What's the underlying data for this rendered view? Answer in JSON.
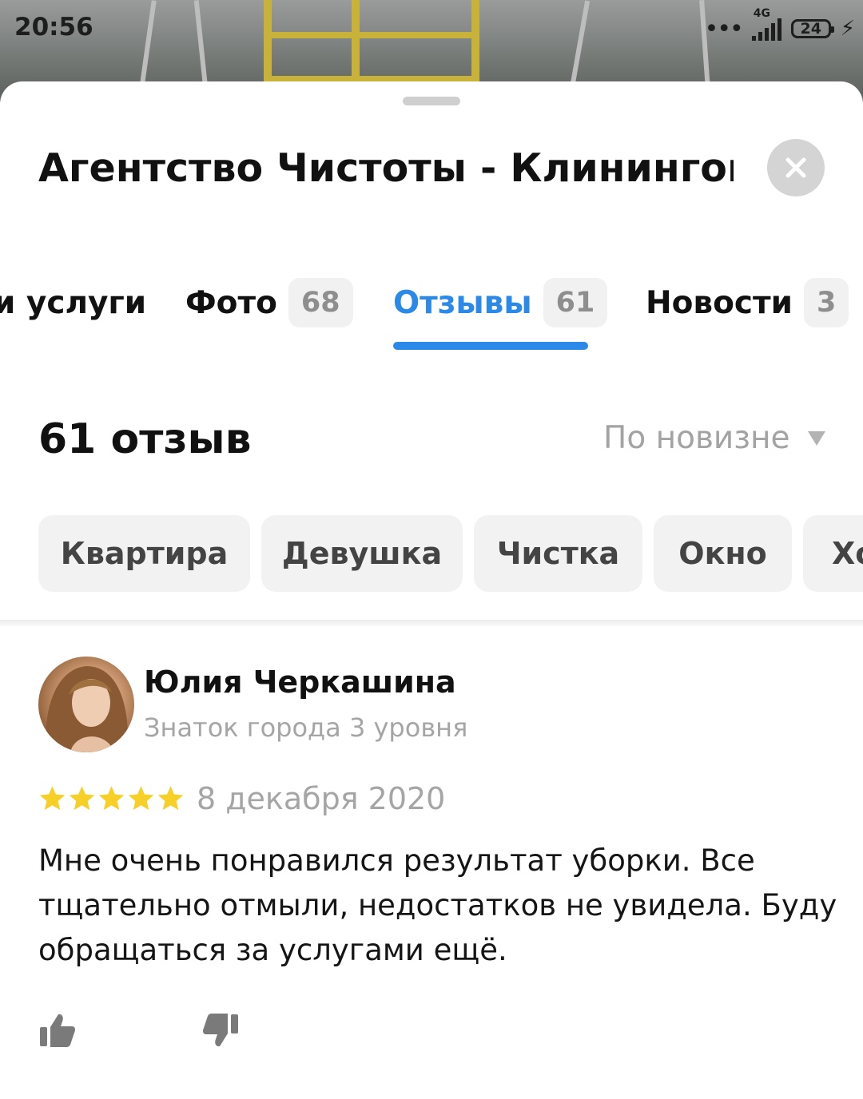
{
  "status_bar": {
    "time": "20:56",
    "dots": "•••",
    "network": "4G",
    "battery": "24"
  },
  "header": {
    "title": "Агентство Чистоты - Клинингов",
    "title_more": "..."
  },
  "tabs": [
    {
      "label": "и услуги",
      "count": "",
      "active": false
    },
    {
      "label": "Фото",
      "count": "68",
      "active": false
    },
    {
      "label": "Отзывы",
      "count": "61",
      "active": true
    },
    {
      "label": "Новости",
      "count": "3",
      "active": false
    }
  ],
  "reviews": {
    "count_label": "61 отзыв",
    "sort_label": "По новизне"
  },
  "chips": [
    "Квартира",
    "Девушка",
    "Чистка",
    "Окно",
    "Хо"
  ],
  "review": {
    "author": "Юлия Черкашина",
    "level": "Знаток города 3 уровня",
    "rating": 5,
    "date": "8 декабря 2020",
    "text": "Мне очень понравился результат уборки. Все тщательно отмыли, недостатков не увидела. Буду обращаться за услугами ещё."
  },
  "colors": {
    "accent": "#2b8ae9",
    "star": "#f6cf27",
    "muted": "#a5a5a5"
  },
  "icons": {
    "close": "close-icon",
    "sort": "triangle-down-icon",
    "like": "thumb-up-icon",
    "dislike": "thumb-down-icon",
    "star": "star-icon"
  }
}
